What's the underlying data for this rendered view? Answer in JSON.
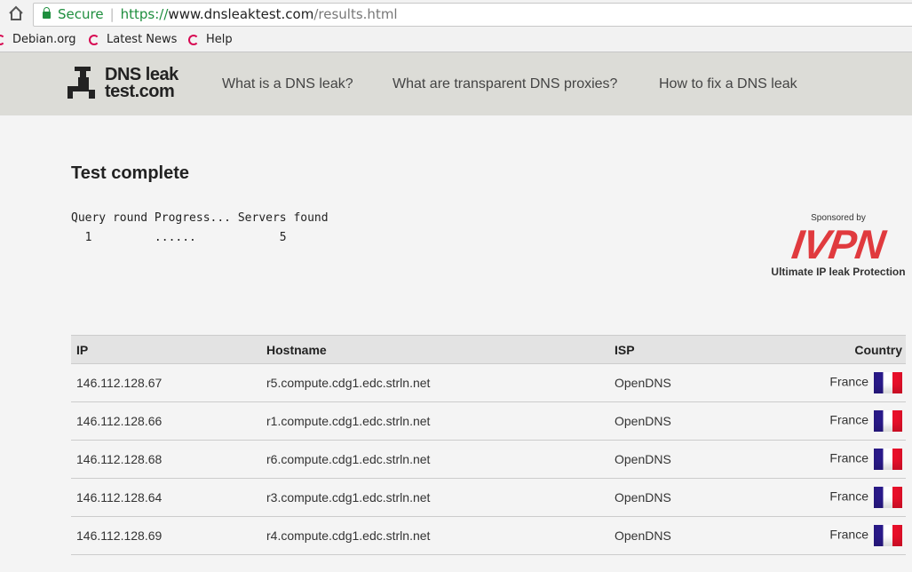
{
  "browser": {
    "secure_label": "Secure",
    "url_scheme": "https://",
    "url_host": "www.dnsleaktest.com",
    "url_path": "/results.html",
    "bookmarks": [
      "Debian.org",
      "Latest News",
      "Help"
    ]
  },
  "site": {
    "logo_line1": "DNS leak",
    "logo_line2": "test.com",
    "nav": [
      "What is a DNS leak?",
      "What are transparent DNS proxies?",
      "How to fix a DNS leak"
    ]
  },
  "main": {
    "title": "Test complete",
    "progress_header": "Query round Progress... Servers found",
    "progress_row": "  1         ......            5"
  },
  "sponsor": {
    "label": "Sponsored by",
    "brand": "IVPN",
    "tagline": "Ultimate IP leak Protection",
    "color": "#e03a3e"
  },
  "table": {
    "headers": [
      "IP",
      "Hostname",
      "ISP",
      "Country"
    ],
    "rows": [
      {
        "ip": "146.112.128.67",
        "host": "r5.compute.cdg1.edc.strln.net",
        "isp": "OpenDNS",
        "country": "France"
      },
      {
        "ip": "146.112.128.66",
        "host": "r1.compute.cdg1.edc.strln.net",
        "isp": "OpenDNS",
        "country": "France"
      },
      {
        "ip": "146.112.128.68",
        "host": "r6.compute.cdg1.edc.strln.net",
        "isp": "OpenDNS",
        "country": "France"
      },
      {
        "ip": "146.112.128.64",
        "host": "r3.compute.cdg1.edc.strln.net",
        "isp": "OpenDNS",
        "country": "France"
      },
      {
        "ip": "146.112.128.69",
        "host": "r4.compute.cdg1.edc.strln.net",
        "isp": "OpenDNS",
        "country": "France"
      }
    ]
  }
}
